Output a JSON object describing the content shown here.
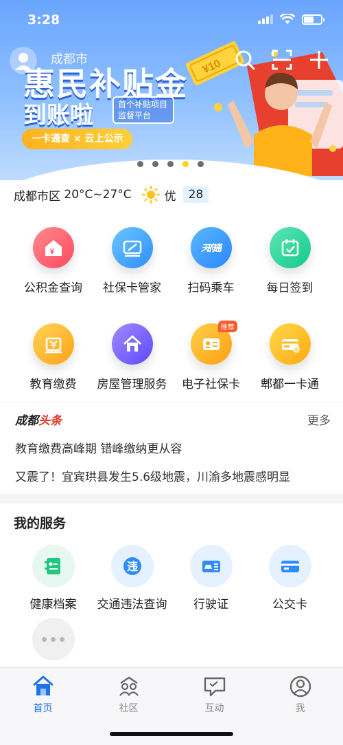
{
  "status": {
    "time": "3:28"
  },
  "banner": {
    "city": "成都市",
    "title": "惠民补贴金",
    "subtitle": "到账啦",
    "badge": "首个补贴项目监督平台",
    "tag": "一卡通查 × 云上公示",
    "money_text": "¥10",
    "active_dot": 3
  },
  "weather": {
    "location": "成都市区",
    "temp": "20°C~27°C",
    "air": "优",
    "aqi": "28"
  },
  "apps_row1": [
    {
      "label": "公积金查询",
      "icon": "house-yuan-icon",
      "color": "#ff5a6a"
    },
    {
      "label": "社保卡管家",
      "icon": "card-icon",
      "color": "#3ba8ff"
    },
    {
      "label": "扫码乘车",
      "icon": "tianfu-icon",
      "color": "#2f9bff",
      "icon_text": "天府通"
    },
    {
      "label": "每日签到",
      "icon": "calendar-check-icon",
      "color": "#22cf95"
    }
  ],
  "apps_row2": [
    {
      "label": "教育缴费",
      "icon": "education-pay-icon",
      "color": "#ffb020"
    },
    {
      "label": "房屋管理服务",
      "icon": "home-icon",
      "color": "#7a63ff"
    },
    {
      "label": "电子社保卡",
      "icon": "id-card-icon",
      "color": "#ffab1e",
      "badge": "推荐"
    },
    {
      "label": "郫都一卡通",
      "icon": "one-card-icon",
      "color": "#ffb81e"
    }
  ],
  "news": {
    "brand_a": "成都",
    "brand_b": "头条",
    "more": "更多",
    "items": [
      "教育缴费高峰期 错峰缴纳更从容",
      "又震了！宜宾珙县发生5.6级地震，川渝多地震感明显"
    ]
  },
  "services": {
    "title": "我的服务",
    "items": [
      {
        "label": "健康档案",
        "icon": "health-record-icon",
        "bg": "#e6f8ef",
        "color": "#20c77f"
      },
      {
        "label": "交通违法查询",
        "icon": "traffic-violation-icon",
        "bg": "#e5f1ff",
        "color": "#2f8cff",
        "icon_text": "违"
      },
      {
        "label": "行驶证",
        "icon": "driving-license-icon",
        "bg": "#e5f1ff",
        "color": "#2f8cff"
      },
      {
        "label": "公交卡",
        "icon": "bus-card-icon",
        "bg": "#e5f1ff",
        "color": "#2f8cff"
      }
    ]
  },
  "tabs": [
    {
      "label": "首页",
      "icon": "home-tab-icon",
      "active": true
    },
    {
      "label": "社区",
      "icon": "community-tab-icon",
      "active": false
    },
    {
      "label": "互动",
      "icon": "chat-tab-icon",
      "active": false
    },
    {
      "label": "我",
      "icon": "profile-tab-icon",
      "active": false
    }
  ],
  "colors": {
    "accent": "#1f74ec",
    "sun": "#ffc21a",
    "news_red": "#e23b2e"
  }
}
